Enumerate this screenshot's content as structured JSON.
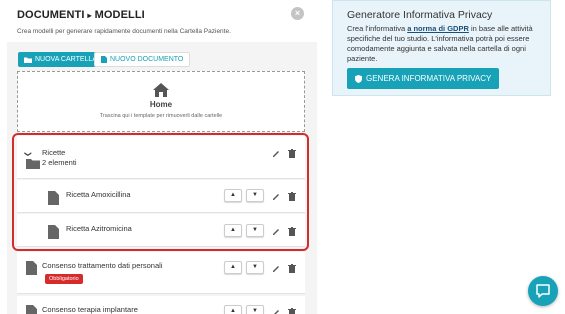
{
  "header": {
    "title_part1": "DOCUMENTI",
    "separator": "▸",
    "title_part2": "MODELLI",
    "subtitle": "Crea modelli per generare rapidamente documenti nella Cartella Paziente.",
    "close_label": "×"
  },
  "toolbar": {
    "new_folder_label": "NUOVA CARTELLA",
    "new_document_label": "NUOVO DOCUMENTO"
  },
  "home_drop": {
    "label": "Home",
    "hint": "Trascina qui i template per rimuoverli dalle cartelle"
  },
  "folder": {
    "name": "Ricette",
    "count": "2 elementi",
    "items": [
      {
        "name": "Ricetta Amoxicillina"
      },
      {
        "name": "Ricetta Azitromicina"
      }
    ]
  },
  "documents": [
    {
      "name": "Consenso trattamento dati personali",
      "badge": "Obbligatorio"
    },
    {
      "name": "Consenso terapia implantare"
    }
  ],
  "privacy_card": {
    "title": "Generatore Informativa Privacy",
    "text_before": "Crea l'informativa ",
    "link_text": "a norma di GDPR",
    "text_after": " in base alle attività specifiche del tuo studio. L'informativa potrà poi essere comodamente aggiunta e salvata nella cartella di ogni paziente.",
    "button_label": "GENERA INFORMATIVA PRIVACY"
  },
  "arrows": {
    "up": "▲",
    "down": "▼"
  },
  "colors": {
    "accent": "#17a2b8",
    "danger": "#d62b2b",
    "card_bg": "#e8f4fa"
  }
}
